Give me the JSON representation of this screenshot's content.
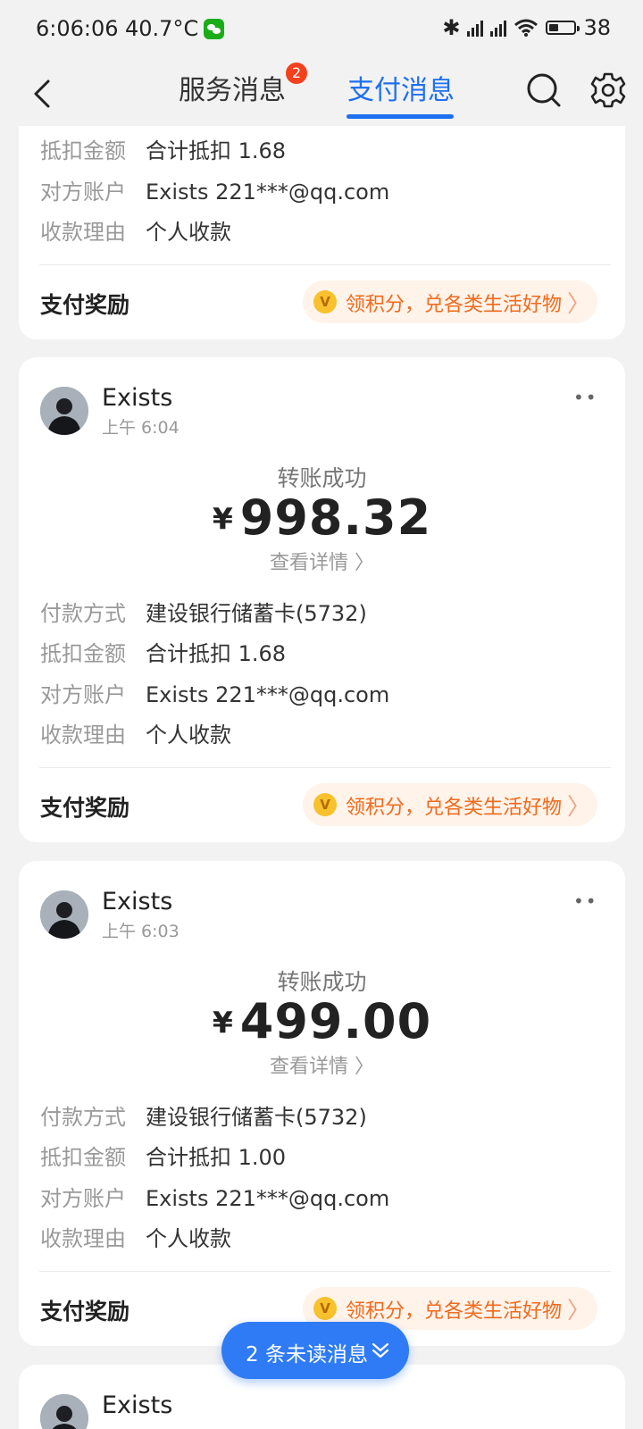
{
  "status_bar": {
    "time": "6:06:06",
    "temperature": "40.7°C",
    "bluetooth": "✱",
    "battery": "38",
    "battery_level": 0.38
  },
  "header": {
    "tabs": [
      {
        "label": "服务消息",
        "badge": "2"
      },
      {
        "label": "支付消息"
      }
    ]
  },
  "top_card": {
    "rows": [
      {
        "key": "抵扣金额",
        "value": "合计抵扣 1.68"
      },
      {
        "key": "对方账户",
        "value": "Exists 221***@qq.com"
      },
      {
        "key": "收款理由",
        "value": "个人收款"
      }
    ],
    "reward_label": "支付奖励",
    "reward_text": "领积分，兑各类生活好物"
  },
  "cards": [
    {
      "sender": "Exists",
      "time": "上午 6:04",
      "more": "••",
      "status": "转账成功",
      "currency": "¥",
      "amount": "998.32",
      "detail_link": "查看详情 〉",
      "rows": [
        {
          "key": "付款方式",
          "value": "建设银行储蓄卡(5732)"
        },
        {
          "key": "抵扣金额",
          "value": "合计抵扣 1.68"
        },
        {
          "key": "对方账户",
          "value": "Exists 221***@qq.com"
        },
        {
          "key": "收款理由",
          "value": "个人收款"
        }
      ],
      "reward_label": "支付奖励",
      "reward_text": "领积分，兑各类生活好物"
    },
    {
      "sender": "Exists",
      "time": "上午 6:03",
      "more": "••",
      "status": "转账成功",
      "currency": "¥",
      "amount": "499.00",
      "detail_link": "查看详情 〉",
      "rows": [
        {
          "key": "付款方式",
          "value": "建设银行储蓄卡(5732)"
        },
        {
          "key": "抵扣金额",
          "value": "合计抵扣 1.00"
        },
        {
          "key": "对方账户",
          "value": "Exists 221***@qq.com"
        },
        {
          "key": "收款理由",
          "value": "个人收款"
        }
      ],
      "reward_label": "支付奖励",
      "reward_text": "领积分，兑各类生活好物"
    },
    {
      "sender": "Exists"
    }
  ],
  "reward_coin": "V",
  "reward_chevron": "〉",
  "unread_button": "2 条未读消息",
  "colors": {
    "accent": "#1e6ff1",
    "badge": "#f5401e",
    "reward_text": "#ef6b1d",
    "reward_bg": "#fff3ea",
    "page_bg": "#f2f2f2"
  },
  "icons": [
    "back-arrow-icon",
    "search-icon",
    "gear-icon",
    "more-dots-icon",
    "chevron-down-double-icon",
    "wechat-icon",
    "bluetooth-icon",
    "signal-icon",
    "wifi-icon",
    "battery-icon"
  ]
}
